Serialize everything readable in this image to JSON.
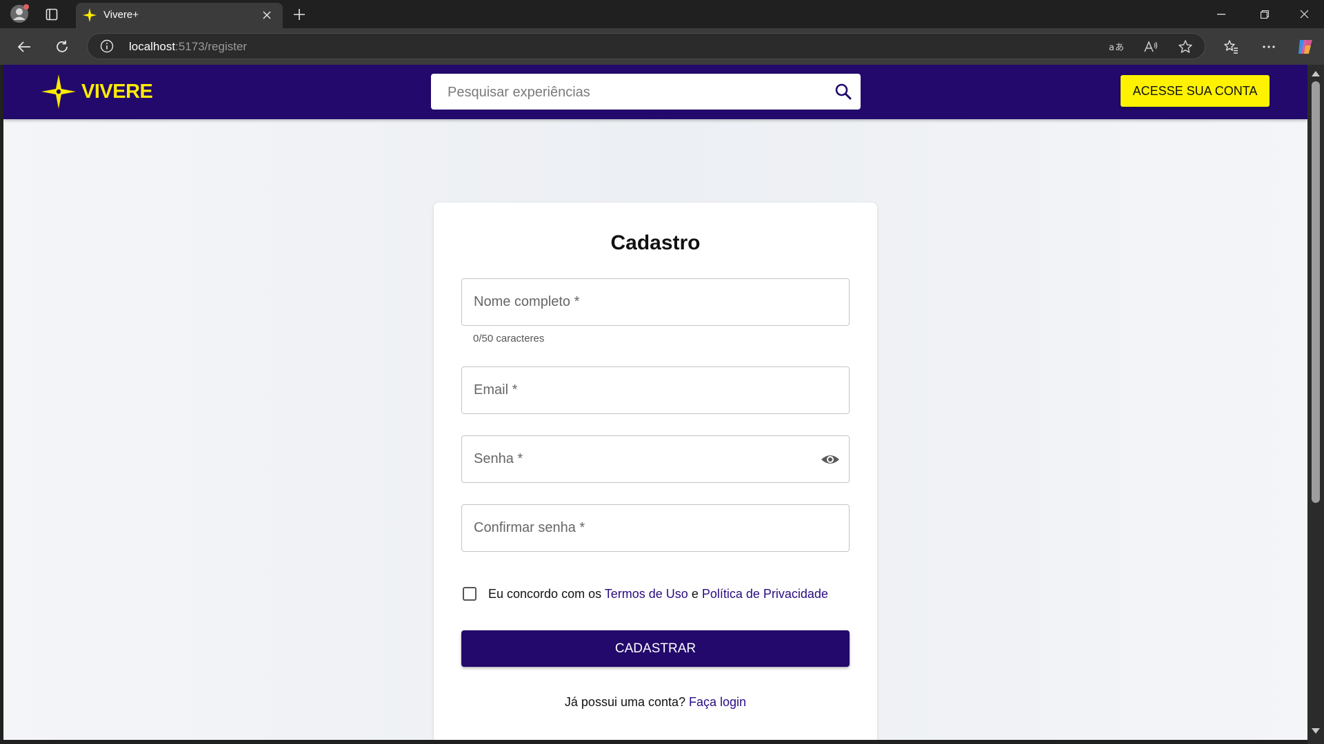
{
  "browser": {
    "tab_title": "Vivere+",
    "url_host": "localhost",
    "url_rest": ":5173/register"
  },
  "header": {
    "brand": "VIVERE",
    "search_placeholder": "Pesquisar experiências",
    "cta_label": "ACESSE SUA CONTA"
  },
  "form": {
    "title": "Cadastro",
    "fields": {
      "name_label": "Nome completo *",
      "name_helper": "0/50 caracteres",
      "email_label": "Email *",
      "password_label": "Senha *",
      "confirm_label": "Confirmar senha *"
    },
    "agree": {
      "prefix": "Eu concordo com os ",
      "terms": "Termos de Uso",
      "middle": " e ",
      "privacy": "Política de Privacidade"
    },
    "submit_label": "CADASTRAR",
    "login_prompt": "Já possui uma conta? ",
    "login_link": "Faça login"
  },
  "colors": {
    "brand_purple": "#22096b",
    "brand_yellow": "#fff200",
    "link": "#2a0b82"
  },
  "icons": [
    "profile-icon",
    "tab-actions-icon",
    "sparkle-icon",
    "close-icon",
    "plus-icon",
    "minimize-icon",
    "restore-icon",
    "back-icon",
    "refresh-icon",
    "info-icon",
    "translate-icon",
    "read-aloud-icon",
    "star-icon",
    "favorites-icon",
    "more-icon",
    "copilot-icon",
    "search-icon",
    "eye-icon"
  ]
}
